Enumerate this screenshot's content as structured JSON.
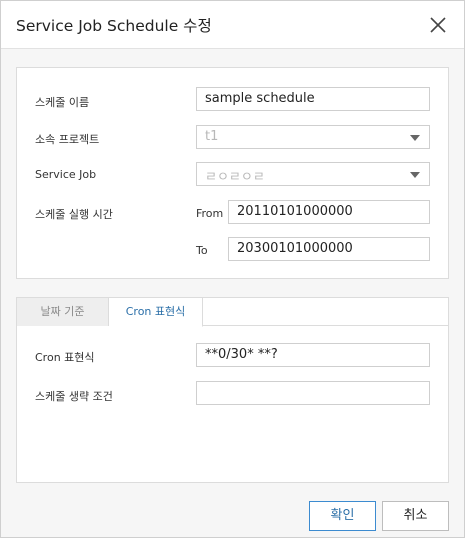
{
  "dialog": {
    "title": "Service Job Schedule 수정",
    "close_icon": "close-icon"
  },
  "form": {
    "schedule_name_label": "스케줄 이름",
    "schedule_name_value": "sample schedule",
    "project_label": "소속 프로젝트",
    "project_value": "t1",
    "service_job_label": "Service Job",
    "service_job_value": "ㄹㅇㄹㅇㄹ",
    "run_time_label": "스케줄 실행 시간",
    "from_label": "From",
    "from_value": "20110101000000",
    "to_label": "To",
    "to_value": "20300101000000"
  },
  "tabs": [
    {
      "label": "날짜 기준",
      "active": false
    },
    {
      "label": "Cron 표현식",
      "active": true
    }
  ],
  "cron": {
    "expression_label": "Cron 표현식",
    "expression_value": "**0/30* **?",
    "skip_condition_label": "스케줄 생략 조건",
    "skip_condition_value": ""
  },
  "buttons": {
    "ok": "확인",
    "cancel": "취소"
  },
  "colors": {
    "accent": "#2b6fa8",
    "accent_border": "#3c8bd0",
    "dialog_bg": "#f6f6f6"
  }
}
